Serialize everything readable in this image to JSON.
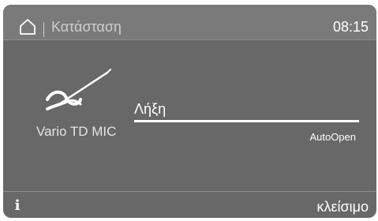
{
  "header": {
    "home_icon": "home-icon",
    "title": "Κατάσταση",
    "time": "08:15"
  },
  "program": {
    "icon": "surgical-instrument-icon",
    "name": "Vario TD MIC"
  },
  "status": {
    "phase_label": "Λήξη",
    "progress_fraction": 1.0,
    "autoopen_label": "AutoOpen"
  },
  "footer": {
    "info_icon": "info-icon",
    "info_label": "i",
    "close_label": "κλείσιμο"
  },
  "colors": {
    "screen_background": "#686868",
    "header_background": "#7a7a7a",
    "text_primary": "#ffffff",
    "text_secondary": "#cfcfcf",
    "progress_fill": "#ffffff",
    "progress_track": "#8a8a8a"
  }
}
